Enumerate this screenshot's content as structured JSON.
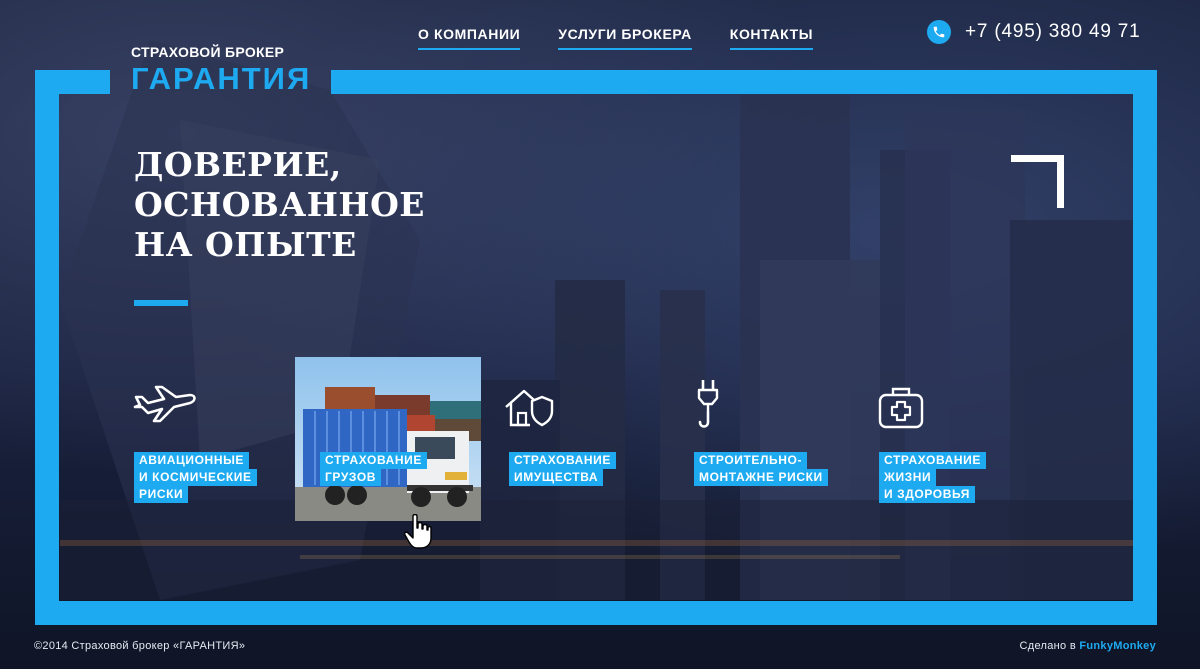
{
  "colors": {
    "accent": "#1eaaf1",
    "background": "#141c33",
    "text": "#ffffff"
  },
  "logo": {
    "subtitle": "СТРАХОВОЙ БРОКЕР",
    "title": "ГАРАНТИЯ"
  },
  "nav": [
    {
      "label": "О КОМПАНИИ"
    },
    {
      "label": "УСЛУГИ БРОКЕРА"
    },
    {
      "label": "КОНТАКТЫ"
    }
  ],
  "phone": {
    "icon": "phone-icon",
    "number": "+7 (495) 380 49 71"
  },
  "hero": {
    "lines": [
      "ДОВЕРИЕ,",
      "ОСНОВАННОЕ",
      "НА ОПЫТЕ"
    ]
  },
  "services": [
    {
      "icon": "airplane-icon",
      "lines": [
        "АВИАЦИОННЫЕ",
        "И КОСМИЧЕСКИЕ",
        "РИСКИ"
      ]
    },
    {
      "icon": "cargo-truck-photo",
      "lines": [
        "СТРАХОВАНИЕ",
        "ГРУЗОВ"
      ]
    },
    {
      "icon": "house-shield-icon",
      "lines": [
        "СТРАХОВАНИЕ",
        "ИМУЩЕСТВА"
      ]
    },
    {
      "icon": "crane-hook-icon",
      "lines": [
        "СТРОИТЕЛЬНО-",
        "МОНТАЖНЕ РИСКИ"
      ]
    },
    {
      "icon": "medical-kit-icon",
      "lines": [
        "СТРАХОВАНИЕ",
        "ЖИЗНИ",
        "И ЗДОРОВЬЯ"
      ]
    }
  ],
  "footer": {
    "copyright": "©2014 Страховой брокер «ГАРАНТИЯ»",
    "made_prefix": "Сделано в",
    "made_brand": "FunkyMonkey"
  }
}
